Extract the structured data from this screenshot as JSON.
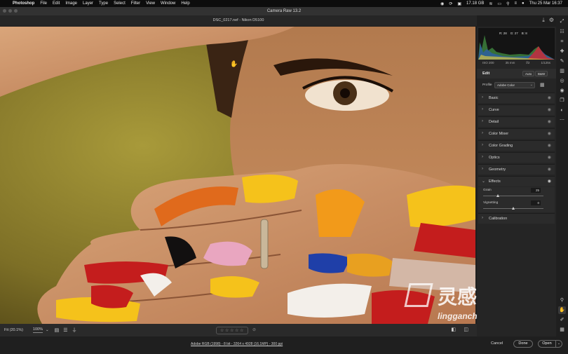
{
  "menubar": {
    "app": "Photoshop",
    "items": [
      "File",
      "Edit",
      "Image",
      "Layer",
      "Type",
      "Select",
      "Filter",
      "View",
      "Window",
      "Help"
    ],
    "memory": "17.18 GB",
    "clock": "Thu 25 Mar 16:37"
  },
  "window": {
    "title": "Camera Raw 13.2"
  },
  "document": {
    "subtitle": "DSC_0217.nef  -  Nikon D5100"
  },
  "histogram": {
    "r": "R: 28",
    "g": "G: 27",
    "b": "B: 8"
  },
  "exif": {
    "iso": "ISO 200",
    "focal": "35 mm",
    "aperture": "f/2",
    "shutter": "1/125s"
  },
  "edit": {
    "label": "Edit",
    "auto_label": "Auto",
    "bw_label": "B&W",
    "profile_label": "Profile",
    "profile_value": "Adobe Color"
  },
  "sections": {
    "basic": "Basic",
    "curve": "Curve",
    "detail": "Detail",
    "color_mixer": "Color Mixer",
    "color_grading": "Color Grading",
    "optics": "Optics",
    "geometry": "Geometry",
    "effects": "Effects",
    "calibration": "Calibration"
  },
  "effects": {
    "grain_label": "Grain",
    "grain_value": "25",
    "grain_fraction": 0.25,
    "vignetting_label": "Vignetting",
    "vignetting_value": "0",
    "vignetting_fraction": 0.5
  },
  "bottom": {
    "fit_label": "Fit (20.1%)",
    "zoom_label": "100%",
    "rating_stars": "☆ ☆ ☆ ☆ ☆"
  },
  "status": {
    "workflow_link": "Adobe RGB (1998) - 8 bit - 3264 x 4928 (16.1MP) - 300 ppi",
    "cancel_label": "Cancel",
    "done_label": "Done",
    "open_label": "Open"
  },
  "watermark": {
    "cn": "灵感中国",
    "url": "lingganchina.com"
  },
  "colors": {
    "accent": "#1473e6",
    "panel": "#252525",
    "background": "#1e1e1e"
  }
}
